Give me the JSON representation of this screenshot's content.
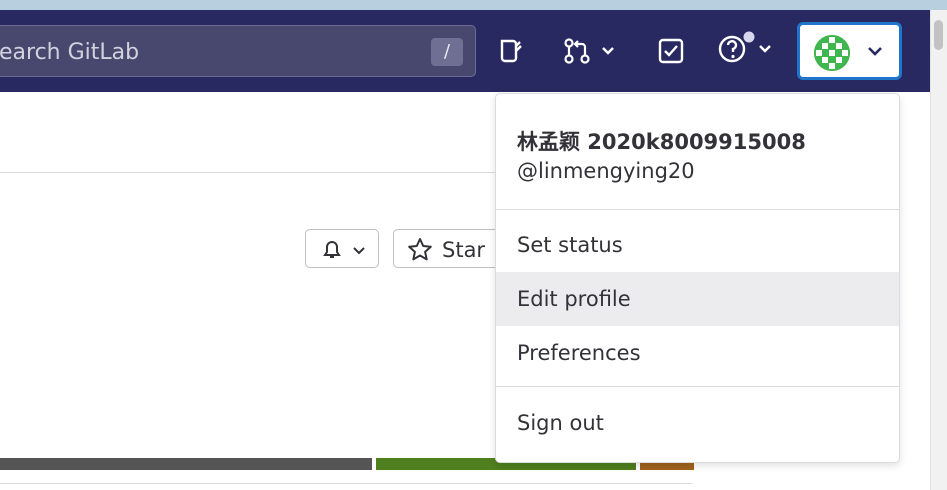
{
  "navbar": {
    "search": {
      "placeholder": "earch GitLab",
      "shortcut": "/"
    },
    "icons": [
      "issues-icon",
      "merge-requests-icon",
      "todos-icon",
      "help-icon",
      "avatar"
    ]
  },
  "project": {
    "star_label": "Star"
  },
  "user_menu": {
    "display_name": "林孟颖 2020k8009915008",
    "username": "@linmengying20",
    "items": [
      {
        "label": "Set status"
      },
      {
        "label": "Edit profile"
      },
      {
        "label": "Preferences"
      }
    ],
    "sign_out": "Sign out"
  },
  "colors": {
    "navbar_bg": "#292961",
    "avatar_border": "#1f75cb",
    "language_bar": [
      "#555555",
      "#4f7f1e",
      "#a0621c"
    ]
  }
}
